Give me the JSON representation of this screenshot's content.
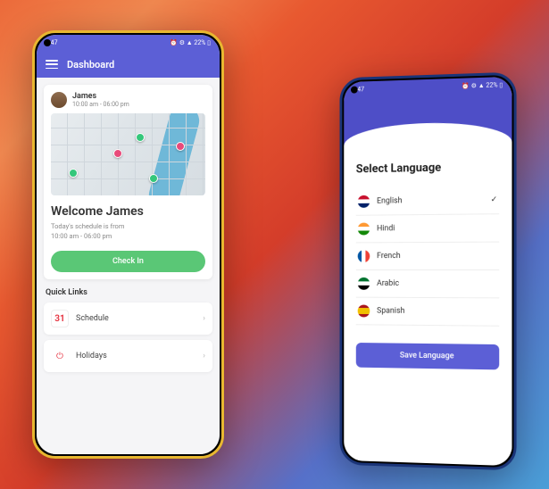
{
  "status": {
    "time": "7:47",
    "icons": "⏰ ⚙ ▲ 22% ▯"
  },
  "phoneA": {
    "header_title": "Dashboard",
    "user": {
      "name": "James",
      "time": "10:00 am - 06:00 pm"
    },
    "welcome": "Welcome James",
    "schedule_line1": "Today's schedule is from",
    "schedule_line2": "10:00 am - 06:00 pm",
    "checkin_label": "Check In",
    "quick_links_title": "Quick Links",
    "links": [
      {
        "label": "Schedule",
        "icon": "31"
      },
      {
        "label": "Holidays",
        "icon": "⏻"
      }
    ]
  },
  "phoneB": {
    "title": "Select Language",
    "langs": [
      {
        "label": "English",
        "flag": "gb",
        "selected": true
      },
      {
        "label": "Hindi",
        "flag": "in"
      },
      {
        "label": "French",
        "flag": "fr"
      },
      {
        "label": "Arabic",
        "flag": "ae"
      },
      {
        "label": "Spanish",
        "flag": "es"
      }
    ],
    "save_label": "Save Language"
  }
}
